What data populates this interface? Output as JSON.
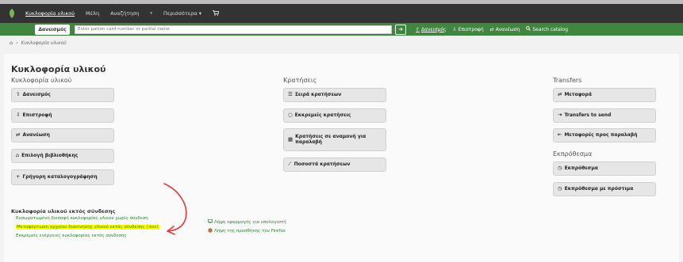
{
  "navbar": {
    "links": [
      "Κυκλοφορία υλικού",
      "Μέλη",
      "Αναζήτηση",
      "Περισσότερα"
    ],
    "caret": "▾"
  },
  "checkbar": {
    "active_tab": "Δανεισμός",
    "placeholder": "Enter patron card number or partial name",
    "submit": "➔",
    "tabs": [
      "Δανεισμός",
      "Επιστροφή",
      "Ανανέωση",
      "Search catalog"
    ]
  },
  "breadcrumb": {
    "current": "Κυκλοφορία υλικού"
  },
  "page": {
    "title": "Κυκλοφορία υλικού",
    "col1_heading": "Κυκλοφορία υλικού",
    "col2_heading": "Κρατήσεις",
    "col3_heading": "Transfers",
    "col3b_heading": "Εκπρόθεσμα"
  },
  "buttons": {
    "checkout": "Δανεισμός",
    "checkin": "Επιστροφή",
    "renew": "Ανανέωση",
    "set_library": "Επιλογή βιβλιοθήκης",
    "fast_cataloging": "Γρήγορη καταλογογράφηση",
    "holds_queue": "Σειρά κρατήσεων",
    "holds_pending": "Εκκρεμείς κρατήσεις",
    "holds_awaiting": "Κρατήσεις σε αναμονή για παραλαβή",
    "holds_ratios": "Ποσοστά κρατήσεων",
    "transfer": "Μεταφορά",
    "transfers_to_send": "Transfers to send",
    "transfers_to_receive": "Μεταφορές προς παραλαβή",
    "overdues": "Εκπρόθεσμα",
    "overdues_fines": "Εκπρόθεσμα με πρόστιμα"
  },
  "offline": {
    "heading": "Κυκλοφορία υλικού εκτός σύνδεσης",
    "links": [
      "Ενσωματωμένη διεπαφή κυκλοφορίας υλικού χωρίς σύνδεση",
      "Μεταφόρτωση αρχείου διακίνησης υλικού εκτός σύνδεσης (.koc)",
      "Εκκρεμείς ενέργειες κυκλοφορίας εκτός σύνδεσης"
    ],
    "downloads": [
      "Λήψη εφαρμογής για υπολογιστή",
      "Λήψη της προσθήκης του Firefox"
    ]
  },
  "colors": {
    "navbar": "#333333",
    "checkbar": "#408540",
    "button": "#e6e6e6",
    "link": "#2e7d32",
    "highlight": "#f7ff00",
    "annotation": "#e53935"
  },
  "icons": {
    "logo": "koha-leaf-icon",
    "cart": "cart-icon",
    "home": "home-icon"
  }
}
